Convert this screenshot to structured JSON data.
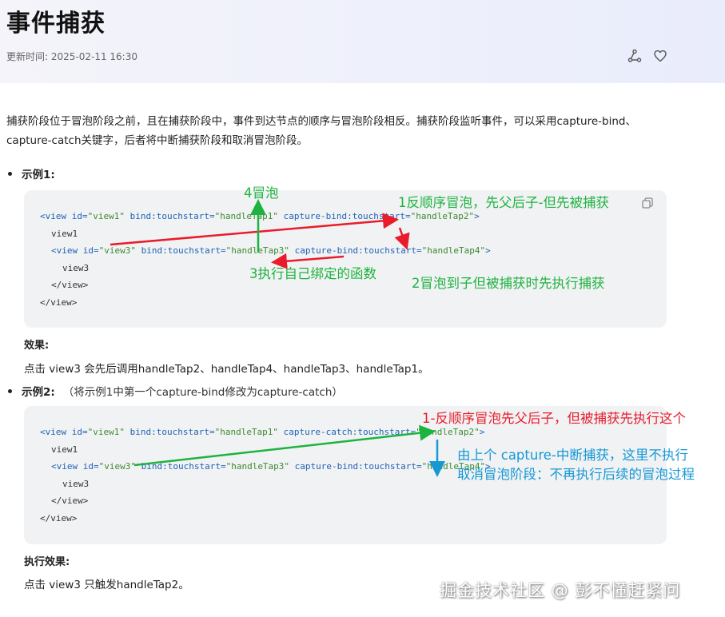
{
  "header": {
    "title": "事件捕获",
    "update_time": "更新时间: 2025-02-11 16:30"
  },
  "intro": "捕获阶段位于冒泡阶段之前，且在捕获阶段中，事件到达节点的顺序与冒泡阶段相反。捕获阶段监听事件，可以采用capture-bind、capture-catch关键字，后者将中断捕获阶段和取消冒泡阶段。",
  "example1": {
    "label": "示例1:",
    "code": {
      "l1": {
        "t1": "<view",
        "a1": " id=",
        "s1": "\"view1\"",
        "a2": " bind:touchstart=",
        "s2": "\"handleTap1\"",
        "a3": " capture-bind:touchstart=",
        "s3": "\"handleTap2\"",
        "t2": ">"
      },
      "l2": "view1",
      "l3": {
        "t1": "<view",
        "a1": " id=",
        "s1": "\"view3\"",
        "a2": " bind:touchstart=",
        "s2": "\"handleTap3\"",
        "a3": " capture-bind:touchstart=",
        "s3": "\"handleTap4\"",
        "t2": ">"
      },
      "l4": "view3",
      "l5": "</view>",
      "l6": "</view>"
    },
    "effect_label": "效果:",
    "effect_text": "点击 view3 会先后调用handleTap2、handleTap4、handleTap3、handleTap1。"
  },
  "example2": {
    "label": "示例2:",
    "note": "（将示例1中第一个capture-bind修改为capture-catch）",
    "code": {
      "l1": {
        "t1": "<view",
        "a1": " id=",
        "s1": "\"view1\"",
        "a2": " bind:touchstart=",
        "s2": "\"handleTap1\"",
        "a3": " capture-catch:touchstart=",
        "s3": "\"handleTap2\"",
        "t2": ">"
      },
      "l2": "view1",
      "l3": {
        "t1": "<view",
        "a1": " id=",
        "s1": "\"view3\"",
        "a2": " bind:touchstart=",
        "s2": "\"handleTap3\"",
        "a3": " capture-bind:touchstart=",
        "s3": "\"handleTap4\"",
        "t2": ">"
      },
      "l4": "view3",
      "l5": "</view>",
      "l6": "</view>"
    },
    "effect_label": "执行效果:",
    "effect_text": "点击 view3 只触发handleTap2。"
  },
  "annotations": {
    "bubble4": "4冒泡",
    "reverse1": "1反顺序冒泡，先父后子-但先被捕获",
    "self3": "3执行自己绑定的函数",
    "bubble2": "2冒泡到子但被捕获时先执行捕获",
    "ex2_reverse": "1-反顺序冒泡先父后子，但被捕获先执行这个",
    "ex2_stop": "由上个 capture-中断捕获，这里不执行",
    "ex2_cancel": "取消冒泡阶段：不再执行后续的冒泡过程"
  },
  "watermark": "掘金技术社区 @ 彭不懂赶紧问",
  "icons": {
    "share": "share-icon",
    "like": "heart-icon",
    "copy": "copy-icon"
  },
  "colors": {
    "annotation_green": "#1db33f",
    "annotation_red": "#e81c2b",
    "annotation_blue": "#1598d4"
  }
}
